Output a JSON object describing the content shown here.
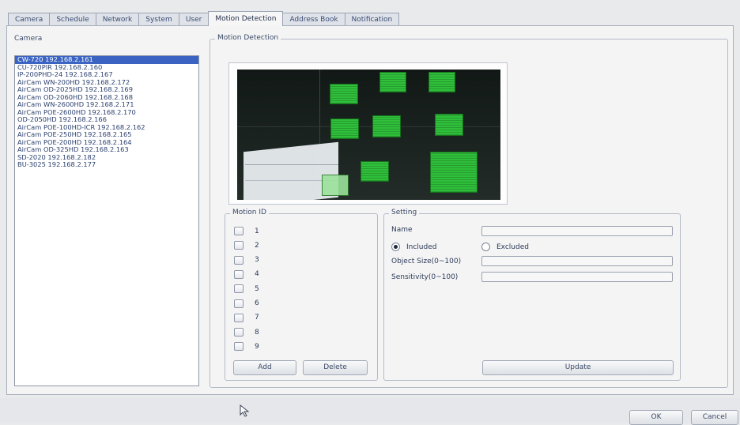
{
  "tabs": [
    "Camera",
    "Schedule",
    "Network",
    "System",
    "User",
    "Motion Detection",
    "Address Book",
    "Notification"
  ],
  "active_tab": "Motion Detection",
  "camera_panel": {
    "label": "Camera",
    "items": [
      "CW-720 192.168.2.161",
      "CU-720PIR 192.168.2.160",
      "IP-200PHD-24 192.168.2.167",
      "AirCam WN-200HD 192.168.2.172",
      "AirCam OD-2025HD 192.168.2.169",
      "AirCam OD-2060HD 192.168.2.168",
      "AirCam WN-2600HD 192.168.2.171",
      "AirCam POE-2600HD 192.168.2.170",
      "OD-2050HD 192.168.2.166",
      "AirCam POE-100HD-ICR 192.168.2.162",
      "AirCam POE-250HD 192.168.2.165",
      "AirCam POE-200HD 192.168.2.164",
      "AirCam OD-325HD 192.168.2.163",
      "SD-2020 192.168.2.182",
      "BU-3025 192.168.2.177"
    ],
    "selected_index": 0
  },
  "motion_detection": {
    "legend": "Motion Detection"
  },
  "motion_id": {
    "legend": "Motion ID",
    "ids": [
      "1",
      "2",
      "3",
      "4",
      "5",
      "6",
      "7",
      "8",
      "9"
    ],
    "add_label": "Add",
    "delete_label": "Delete"
  },
  "setting": {
    "legend": "Setting",
    "name_label": "Name",
    "name_value": "",
    "included_label": "Included",
    "excluded_label": "Excluded",
    "mode": "Included",
    "object_size_label": "Object Size(0~100)",
    "object_size_value": "",
    "sensitivity_label": "Sensitivity(0~100)",
    "sensitivity_value": "",
    "update_label": "Update"
  },
  "footer": {
    "ok_label": "OK",
    "cancel_label": "Cancel"
  },
  "colors": {
    "region": "#2fbf3a",
    "selection": "#3a63c2"
  }
}
